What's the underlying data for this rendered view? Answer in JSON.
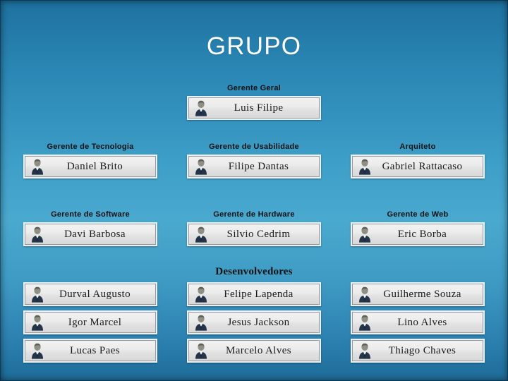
{
  "slide": {
    "title": "GRUPO",
    "background_top_color": "#1d719f",
    "background_mid_color": "#4aa9cf",
    "background_bottom_color": "#1d6b98"
  },
  "top_group": {
    "role_label": "Gerente Geral",
    "person": {
      "name": "Luis Filipe",
      "icon": "person-icon"
    }
  },
  "manager_rows": [
    {
      "cells": [
        {
          "role_label": "Gerente de Tecnologia",
          "person": {
            "name": "Daniel Brito",
            "icon": "person-icon"
          }
        },
        {
          "role_label": "Gerente de Usabilidade",
          "person": {
            "name": "Filipe Dantas",
            "icon": "person-icon"
          }
        },
        {
          "role_label": "Arquiteto",
          "person": {
            "name": "Gabriel Rattacaso",
            "icon": "person-icon"
          }
        }
      ]
    },
    {
      "cells": [
        {
          "role_label": "Gerente de Software",
          "person": {
            "name": "Davi Barbosa",
            "icon": "person-icon"
          }
        },
        {
          "role_label": "Gerente de Hardware",
          "person": {
            "name": "Silvio Cedrim",
            "icon": "person-icon"
          }
        },
        {
          "role_label": "Gerente de Web",
          "person": {
            "name": "Eric Borba",
            "icon": "person-icon"
          }
        }
      ]
    }
  ],
  "developers": {
    "section_title": "Desenvolvedores",
    "people": [
      {
        "name": "Durval Augusto",
        "icon": "person-icon"
      },
      {
        "name": "Felipe Lapenda",
        "icon": "person-icon"
      },
      {
        "name": "Guilherme Souza",
        "icon": "person-icon"
      },
      {
        "name": "Igor Marcel",
        "icon": "person-icon"
      },
      {
        "name": "Jesus Jackson",
        "icon": "person-icon"
      },
      {
        "name": "Lino Alves",
        "icon": "person-icon"
      },
      {
        "name": "Lucas Paes",
        "icon": "person-icon"
      },
      {
        "name": "Marcelo Alves",
        "icon": "person-icon"
      },
      {
        "name": "Thiago Chaves",
        "icon": "person-icon"
      }
    ]
  }
}
